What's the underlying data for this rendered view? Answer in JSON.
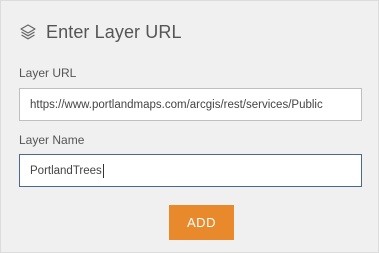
{
  "header": {
    "icon": "layers-icon",
    "title": "Enter Layer URL"
  },
  "layer_url": {
    "label": "Layer URL",
    "value": "https://www.portlandmaps.com/arcgis/rest/services/Public"
  },
  "layer_name": {
    "label": "Layer Name",
    "value": "PortlandTrees"
  },
  "add_button": {
    "label": "ADD",
    "color": "#e8892c"
  }
}
